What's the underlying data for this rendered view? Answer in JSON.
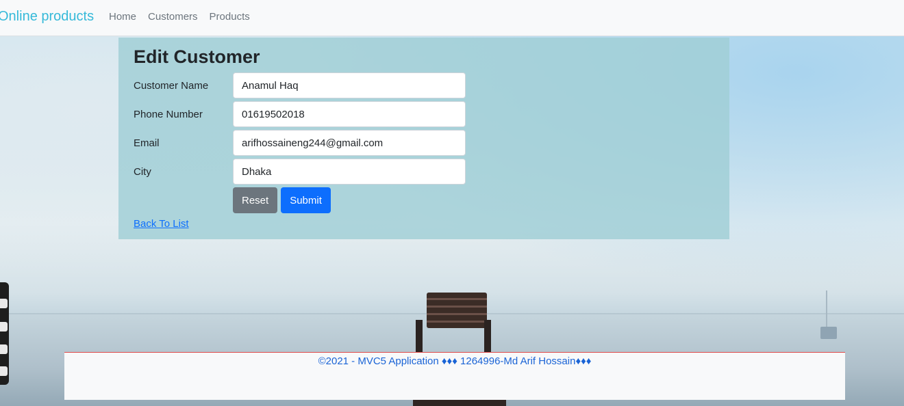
{
  "navbar": {
    "brand": "Online products",
    "links": [
      "Home",
      "Customers",
      "Products"
    ]
  },
  "form": {
    "title": "Edit Customer",
    "fields": [
      {
        "label": "Customer Name",
        "value": "Anamul Haq"
      },
      {
        "label": "Phone Number",
        "value": "01619502018"
      },
      {
        "label": "Email",
        "value": "arifhossaineng244@gmail.com"
      },
      {
        "label": "City",
        "value": "Dhaka"
      }
    ],
    "reset_label": "Reset",
    "submit_label": "Submit",
    "back_link": "Back To List"
  },
  "footer": {
    "text": "©2021 - MVC5 Application ♦♦♦ 1264996-Md Arif Hossain♦♦♦"
  },
  "side_toolbar": {
    "icons": [
      "camera-icon",
      "video-icon",
      "screen-icon",
      "settings-icon"
    ]
  },
  "colors": {
    "brand": "#35b9d9",
    "submit": "#0d6efd",
    "reset": "#6c757d",
    "footer_border": "#e04848"
  }
}
